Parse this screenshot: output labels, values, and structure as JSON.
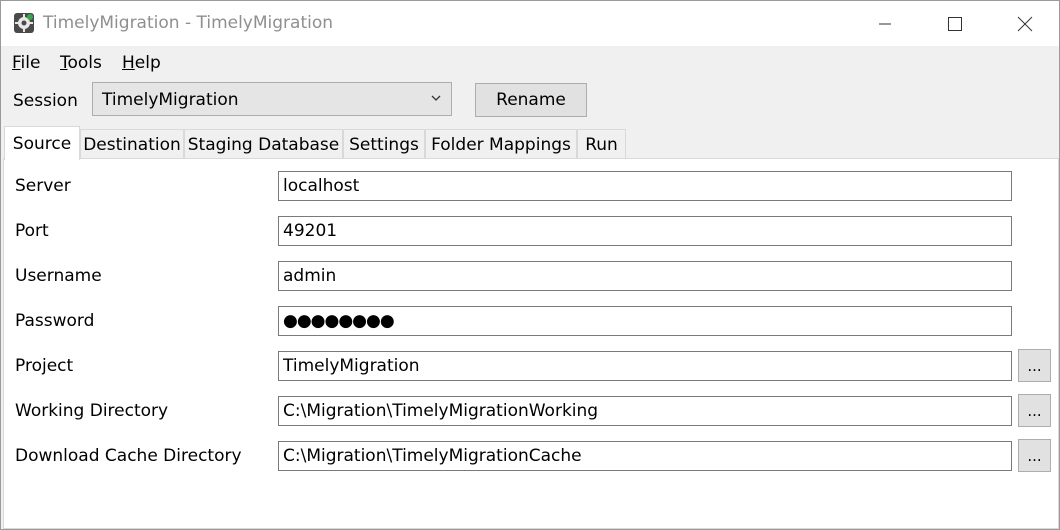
{
  "window": {
    "title": "TimelyMigration - TimelyMigration"
  },
  "menu": {
    "items": [
      {
        "access": "F",
        "rest": "ile"
      },
      {
        "access": "T",
        "rest": "ools"
      },
      {
        "access": "H",
        "rest": "elp"
      }
    ]
  },
  "session": {
    "label": "Session",
    "selected": "TimelyMigration",
    "rename_label": "Rename"
  },
  "tabs": [
    "Source",
    "Destination",
    "Staging Database",
    "Settings",
    "Folder Mappings",
    "Run"
  ],
  "source": {
    "server_label": "Server",
    "server_value": "localhost",
    "port_label": "Port",
    "port_value": "49201",
    "username_label": "Username",
    "username_value": "admin",
    "password_label": "Password",
    "password_value": "●●●●●●●●",
    "project_label": "Project",
    "project_value": "TimelyMigration",
    "working_dir_label": "Working Directory",
    "working_dir_value": "C:\\Migration\\TimelyMigrationWorking",
    "cache_dir_label": "Download Cache Directory",
    "cache_dir_value": "C:\\Migration\\TimelyMigrationCache",
    "browse_label": "..."
  },
  "icons": {
    "app": "gear-icon",
    "minimize": "minimize-icon",
    "maximize": "maximize-icon",
    "close": "close-icon",
    "dropdown": "chevron-down-icon"
  }
}
